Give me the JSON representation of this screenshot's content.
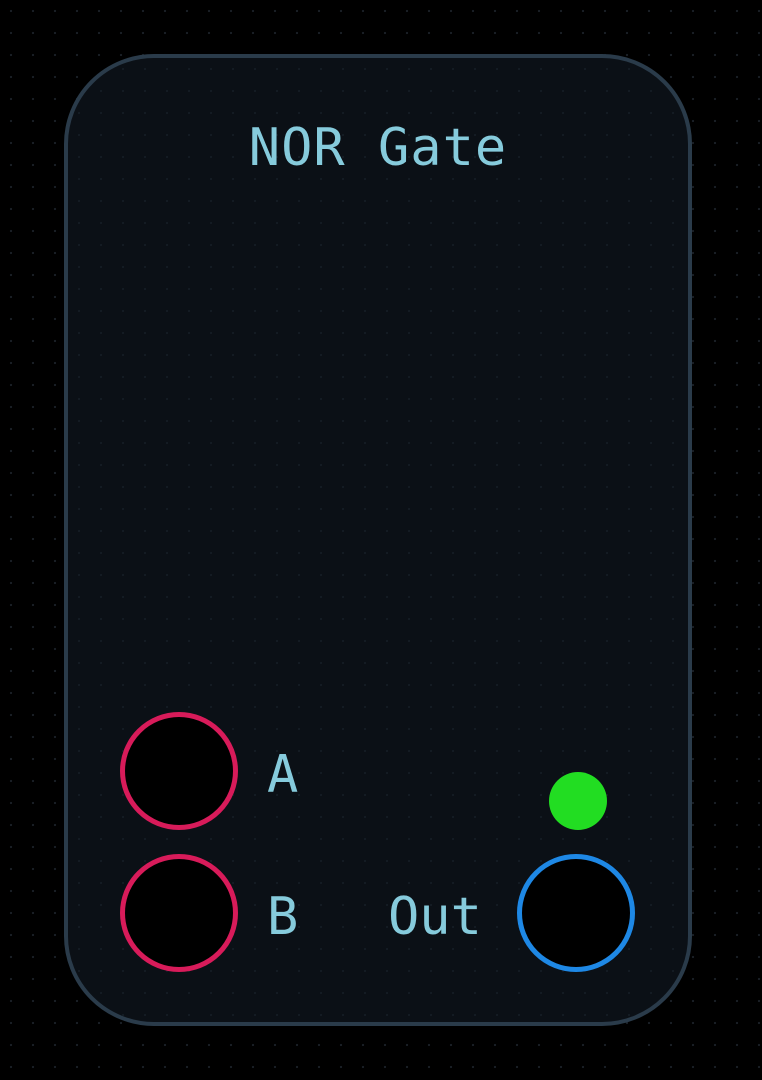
{
  "node": {
    "title": "NOR Gate",
    "inputs": [
      {
        "label": "A"
      },
      {
        "label": "B"
      }
    ],
    "output": {
      "label": "Out"
    },
    "status": {
      "icon": "status-led-icon",
      "color": "#22dd22",
      "state": "on"
    }
  },
  "colors": {
    "background": "#000000",
    "node_fill": "#0b1016",
    "node_border": "#2a3b4a",
    "text": "#86cbdc",
    "input_port": "#d81b5a",
    "output_port": "#1e88e5"
  }
}
